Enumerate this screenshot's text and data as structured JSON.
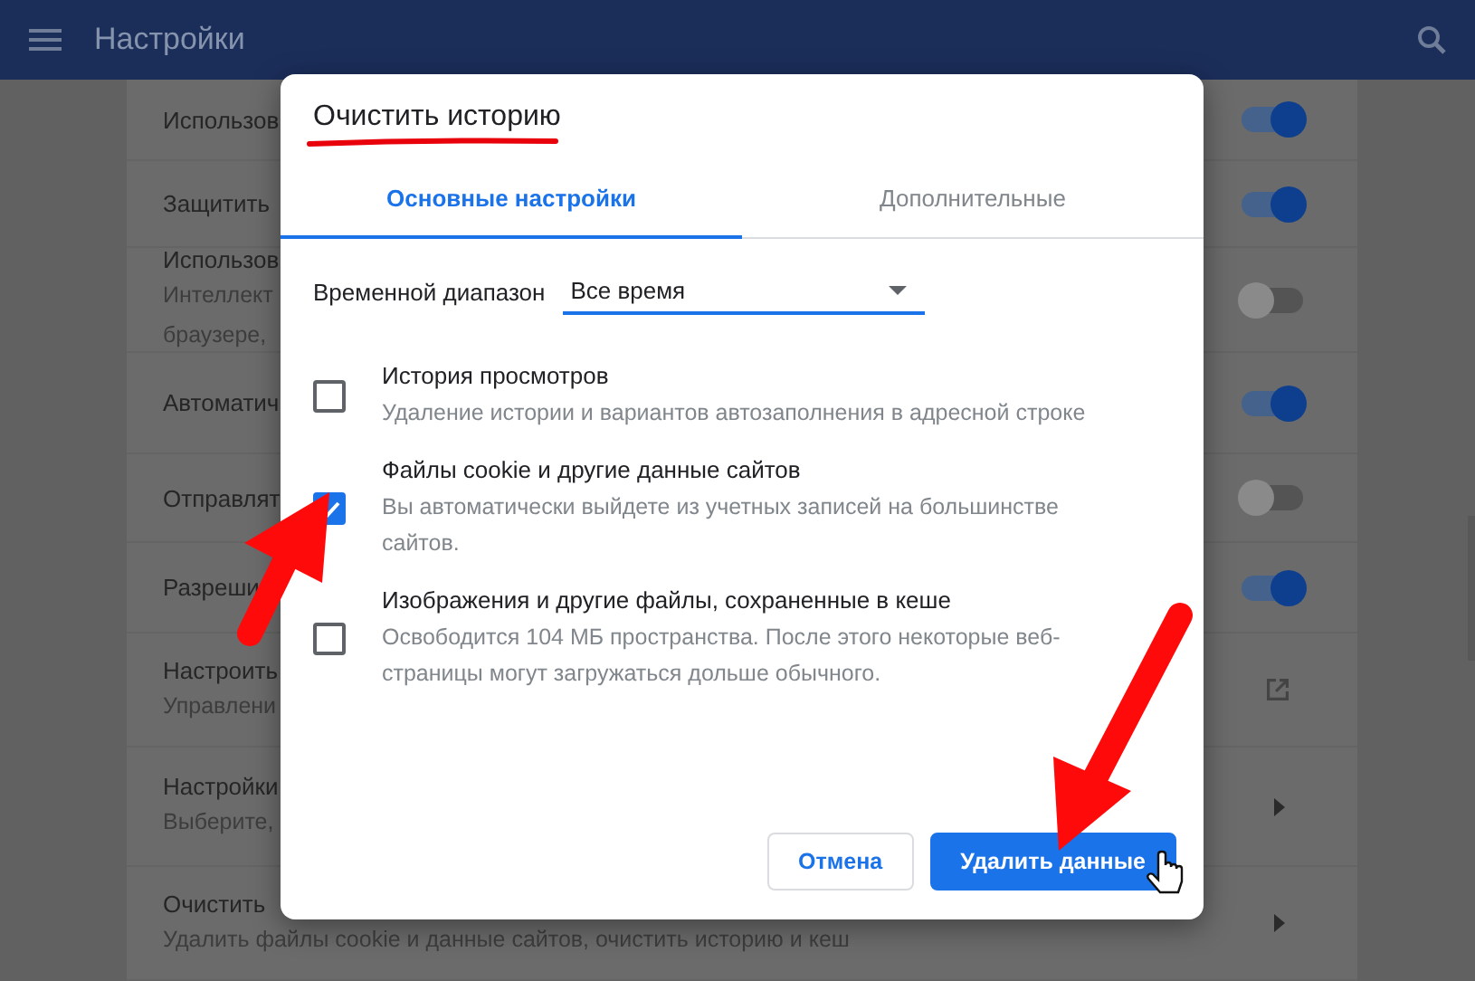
{
  "header": {
    "title": "Настройки"
  },
  "settings_rows": [
    {
      "title": "Использов",
      "kind": "toggle",
      "on": true
    },
    {
      "title": "Защитить",
      "kind": "toggle",
      "on": true
    },
    {
      "title": "Использов",
      "subtitle": [
        "Интеллект",
        "браузере,"
      ],
      "kind": "toggle",
      "on": false
    },
    {
      "title": "Автоматич",
      "kind": "toggle",
      "on": true
    },
    {
      "title": "Отправлят",
      "kind": "toggle",
      "on": false
    },
    {
      "title": "Разреши",
      "kind": "toggle",
      "on": true
    },
    {
      "title": "Настроить",
      "subtitle": [
        "Управлени"
      ],
      "kind": "external"
    },
    {
      "title": "Настройки",
      "subtitle": [
        "Выберите,"
      ],
      "kind": "chevron"
    },
    {
      "title": "Очистить",
      "subtitle": [
        "Удалить файлы cookie и данные сайтов, очистить историю и кеш"
      ],
      "kind": "chevron"
    }
  ],
  "dialog": {
    "title": "Очистить историю",
    "tabs": [
      {
        "label": "Основные настройки",
        "selected": true
      },
      {
        "label": "Дополнительные",
        "selected": false
      }
    ],
    "time_range": {
      "label": "Временной диапазон",
      "value": "Все время"
    },
    "items": [
      {
        "title": "История просмотров",
        "description": "Удаление истории и вариантов автозаполнения в адресной строке",
        "checked": false
      },
      {
        "title": "Файлы cookie и другие данные сайтов",
        "description": "Вы автоматически выйдете из учетных записей на большинстве сайтов.",
        "checked": true
      },
      {
        "title": "Изображения и другие файлы, сохраненные в кеше",
        "description": "Освободится 104 МБ пространства. После этого некоторые веб-страницы могут загружаться дольше обычного.",
        "checked": false
      }
    ],
    "buttons": [
      {
        "label": "Отмена",
        "kind": "secondary"
      },
      {
        "label": "Удалить данные",
        "kind": "primary"
      }
    ]
  }
}
